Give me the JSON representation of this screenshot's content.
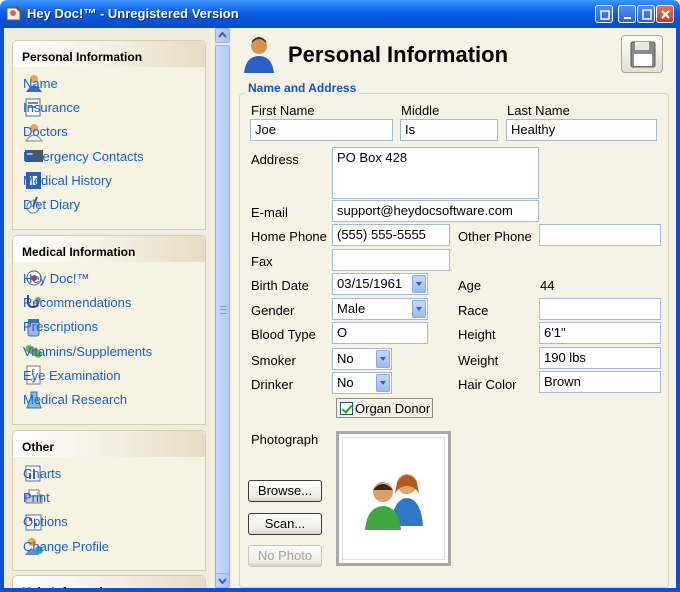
{
  "window": {
    "title": "Hey Doc!™ - Unregistered Version"
  },
  "sidebar": {
    "sections": [
      {
        "title": "Personal Information",
        "items": [
          {
            "label": "Name",
            "icon": "person-icon"
          },
          {
            "label": "Insurance",
            "icon": "insurance-card-icon"
          },
          {
            "label": "Doctors",
            "icon": "doctor-icon"
          },
          {
            "label": "Emergency Contacts",
            "icon": "emergency-contacts-icon"
          },
          {
            "label": "Medical History",
            "icon": "medical-history-icon"
          },
          {
            "label": "Diet Diary",
            "icon": "diet-diary-icon"
          }
        ]
      },
      {
        "title": "Medical Information",
        "items": [
          {
            "label": "Hey Doc!™",
            "icon": "heydoc-icon"
          },
          {
            "label": "Recommendations",
            "icon": "stethoscope-icon"
          },
          {
            "label": "Prescriptions",
            "icon": "prescription-icon"
          },
          {
            "label": "Vitamins/Supplements",
            "icon": "pill-icon"
          },
          {
            "label": "Eye Examination",
            "icon": "eye-chart-icon"
          },
          {
            "label": "Medical Research",
            "icon": "flask-icon"
          }
        ]
      },
      {
        "title": "Other",
        "items": [
          {
            "label": "Charts",
            "icon": "charts-icon"
          },
          {
            "label": "Print",
            "icon": "print-icon"
          },
          {
            "label": "Options",
            "icon": "options-icon"
          },
          {
            "label": "Change Profile",
            "icon": "change-profile-icon"
          }
        ]
      },
      {
        "title": "Help Information",
        "items": []
      }
    ]
  },
  "main": {
    "title": "Personal Information",
    "group_title": "Name and Address",
    "labels": {
      "first_name": "First Name",
      "middle": "Middle",
      "last_name": "Last Name",
      "address": "Address",
      "email": "E-mail",
      "home_phone": "Home Phone",
      "other_phone": "Other Phone",
      "fax": "Fax",
      "birth_date": "Birth Date",
      "age": "Age",
      "gender": "Gender",
      "race": "Race",
      "blood_type": "Blood Type",
      "height": "Height",
      "smoker": "Smoker",
      "weight": "Weight",
      "drinker": "Drinker",
      "hair_color": "Hair Color",
      "photograph": "Photograph"
    },
    "values": {
      "first_name": "Joe",
      "middle": "Is",
      "last_name": "Healthy",
      "address": "PO Box 428",
      "email": "support@heydocsoftware.com",
      "home_phone": "(555) 555-5555",
      "other_phone": "",
      "fax": "",
      "birth_date": "03/15/1961",
      "age": "44",
      "gender": "Male",
      "race": "",
      "blood_type": "O",
      "height": "6'1\"",
      "smoker": "No",
      "weight": "190 lbs",
      "drinker": "No",
      "hair_color": "Brown",
      "organ_donor_label": "Organ Donor",
      "organ_donor": true
    },
    "buttons": {
      "browse": "Browse...",
      "scan": "Scan...",
      "no_photo": "No Photo"
    }
  },
  "colors": {
    "titlebar": "#0a5fe8",
    "link": "#1a5fc8",
    "group_title": "#1552c2",
    "background": "#f5f3e6"
  }
}
